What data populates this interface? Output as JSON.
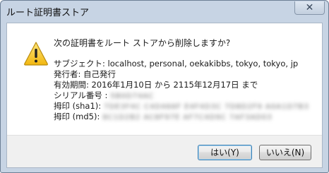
{
  "window": {
    "title": "ルート証明書ストア",
    "close_label": "✕"
  },
  "dialog": {
    "icon": "warning-icon",
    "question": "次の証明書をルート ストアから削除しますか?",
    "subject": "サブジェクト: localhost, personal, oekakibbs, tokyo, tokyo, jp",
    "issuer": "発行者: 自己発行",
    "validity": "有効期間: 2016年1月10日 から 2115年12月17日 まで",
    "serial_label": "シリアル番号 :",
    "serial_value": "5B0D74AC",
    "sha1_label": "拇印 (sha1):",
    "sha1_value": "7DE3F4C C4D466F E4F4D3C 7D8D2F9 A0A1D7B3",
    "md5_label": "拇印 (md5):",
    "md5_value": "8C1D2B2 AC8F97E AF7C4D9C 7AF3AD03"
  },
  "buttons": {
    "yes": "はい(Y)",
    "no": "いいえ(N)"
  },
  "colors": {
    "frame": "#c7d4e4",
    "warning_yellow": "#f6c51e",
    "default_button_border": "#3c7fb1"
  }
}
